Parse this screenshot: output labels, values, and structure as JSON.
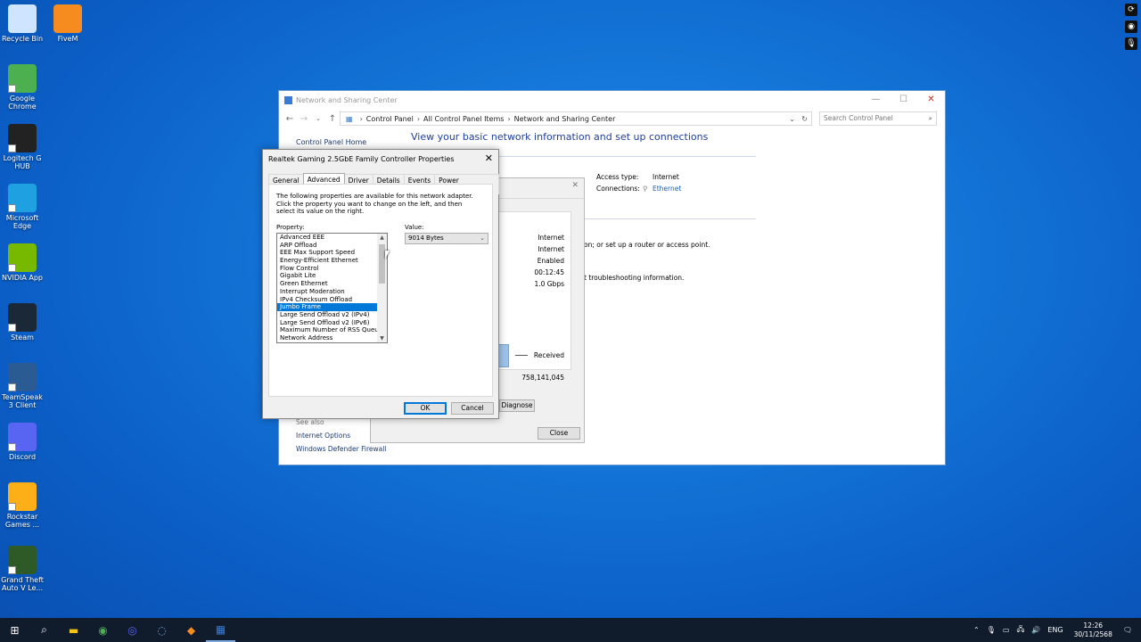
{
  "desktop": {
    "icons": [
      {
        "label": "Recycle Bin",
        "icon": "recycle-bin-icon",
        "color": "#cfe4ff"
      },
      {
        "label": "FiveM",
        "icon": "fivem-icon",
        "color": "#f68b1f"
      },
      {
        "label": "Google Chrome",
        "icon": "chrome-icon",
        "color": "#4caf50"
      },
      {
        "label": "Logitech G HUB",
        "icon": "logitech-icon",
        "color": "#222222"
      },
      {
        "label": "Microsoft Edge",
        "icon": "edge-icon",
        "color": "#1fa0e0"
      },
      {
        "label": "NVIDIA App",
        "icon": "nvidia-icon",
        "color": "#76b900"
      },
      {
        "label": "Steam",
        "icon": "steam-icon",
        "color": "#1b2838"
      },
      {
        "label": "TeamSpeak 3 Client",
        "icon": "teamspeak-icon",
        "color": "#2b5b93"
      },
      {
        "label": "Discord",
        "icon": "discord-icon",
        "color": "#5865f2"
      },
      {
        "label": "Rockstar Games ...",
        "icon": "rockstar-icon",
        "color": "#fcaf17"
      },
      {
        "label": "Grand Theft Auto V Le...",
        "icon": "gta-icon",
        "color": "#2d5a27"
      }
    ]
  },
  "nsc": {
    "title": "Network and Sharing Center",
    "breadcrumb": [
      "Control Panel",
      "All Control Panel Items",
      "Network and Sharing Center"
    ],
    "search_placeholder": "Search Control Panel",
    "heading": "View your basic network information and set up connections",
    "cp_home": "Control Panel Home",
    "access_type_label": "Access type:",
    "access_type_value": "Internet",
    "connections_label": "Connections:",
    "connections_value": "Ethernet",
    "setup_text": "on; or set up a router or access point.",
    "troubleshoot_text": "t troubleshooting information.",
    "see_also": "See also",
    "internet_options": "Internet Options",
    "firewall": "Windows Defender Firewall"
  },
  "ethernet_status": {
    "values": [
      "Internet",
      "Internet",
      "Enabled",
      "00:12:45",
      "1.0 Gbps"
    ],
    "received_label": "Received",
    "received_bytes": "758,141,045",
    "diagnose_label": "Diagnose",
    "close_label": "Close"
  },
  "props": {
    "title": "Realtek Gaming 2.5GbE Family Controller Properties",
    "tabs": [
      "General",
      "Advanced",
      "Driver",
      "Details",
      "Events",
      "Power Management"
    ],
    "description": "The following properties are available for this network adapter. Click the property you want to change on the left, and then select its value on the right.",
    "property_label": "Property:",
    "value_label": "Value:",
    "properties": [
      "Advanced EEE",
      "ARP Offload",
      "EEE Max Support Speed",
      "Energy-Efficient Ethernet",
      "Flow Control",
      "Gigabit Lite",
      "Green Ethernet",
      "Interrupt Moderation",
      "IPv4 Checksum Offload",
      "Jumbo Frame",
      "Large Send Offload v2 (IPv4)",
      "Large Send Offload v2 (IPv6)",
      "Maximum Number of RSS Queues",
      "Network Address"
    ],
    "selected_property": "Jumbo Frame",
    "value": "9014 Bytes",
    "ok_label": "OK",
    "cancel_label": "Cancel"
  },
  "taskbar": {
    "items": [
      "start-icon",
      "search-icon",
      "file-explorer-icon",
      "chrome-icon",
      "discord-icon",
      "teamspeak-icon",
      "fivem-icon",
      "control-panel-icon"
    ],
    "language": "ENG",
    "time": "12:26",
    "date": "30/11/2568"
  }
}
